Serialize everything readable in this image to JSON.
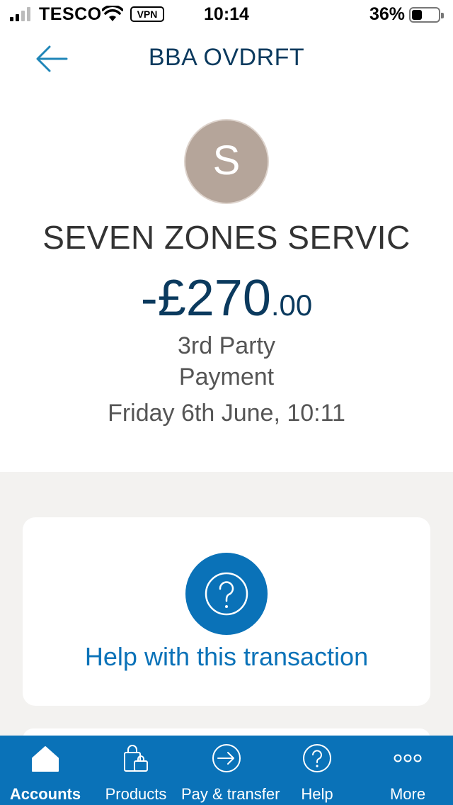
{
  "status_bar": {
    "carrier": "TESCO",
    "vpn": "VPN",
    "time": "10:14",
    "battery": "36%"
  },
  "header": {
    "title": "BBA OVDRFT",
    "back_icon": "arrow-left-icon"
  },
  "transaction": {
    "avatar_initial": "S",
    "merchant": "SEVEN ZONES SERVIC",
    "amount_main": "-£270",
    "amount_pence": ".00",
    "type_line1": "3rd Party",
    "type_line2": "Payment",
    "date": "Friday 6th June, 10:11"
  },
  "help": {
    "label": "Help with this transaction",
    "icon": "question-circle-icon"
  },
  "tabs": [
    {
      "label": "Accounts",
      "icon": "home-icon",
      "active": true
    },
    {
      "label": "Products",
      "icon": "shopping-bag-icon",
      "active": false
    },
    {
      "label": "Pay & transfer",
      "icon": "arrow-circle-icon",
      "active": false
    },
    {
      "label": "Help",
      "icon": "question-circle-icon",
      "active": false
    },
    {
      "label": "More",
      "icon": "more-dots-icon",
      "active": false
    }
  ],
  "colors": {
    "brand_blue": "#0a72b8",
    "navy": "#0b3a5e",
    "avatar": "#b5a59a",
    "grey_bg": "#f3f2f0"
  }
}
